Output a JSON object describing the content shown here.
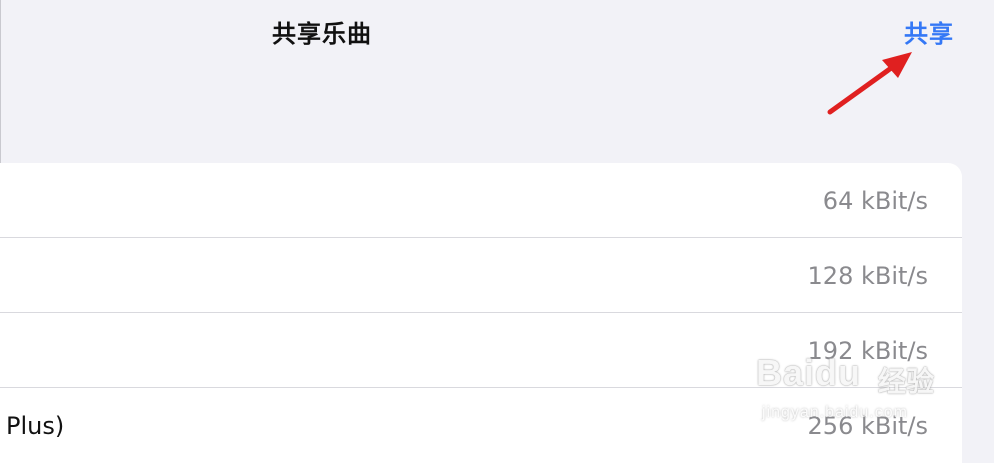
{
  "nav": {
    "title": "共享乐曲",
    "share_label": "共享"
  },
  "quality_options": [
    {
      "label": "",
      "value": "64 kBit/s"
    },
    {
      "label": "",
      "value": "128 kBit/s"
    },
    {
      "label": "",
      "value": "192 kBit/s"
    },
    {
      "label": "Plus)",
      "value": "256 kBit/s"
    }
  ],
  "annotation": {
    "arrow_icon": "red-arrow-icon",
    "arrow_color": "#e02020"
  },
  "watermark": {
    "logo": "Baidu",
    "brand_cn": "经验",
    "url": "jingyan.baidu.com"
  },
  "colors": {
    "accent": "#3478f6",
    "background": "#f2f2f7",
    "card": "#ffffff",
    "secondary_text": "#8a8a8e"
  }
}
